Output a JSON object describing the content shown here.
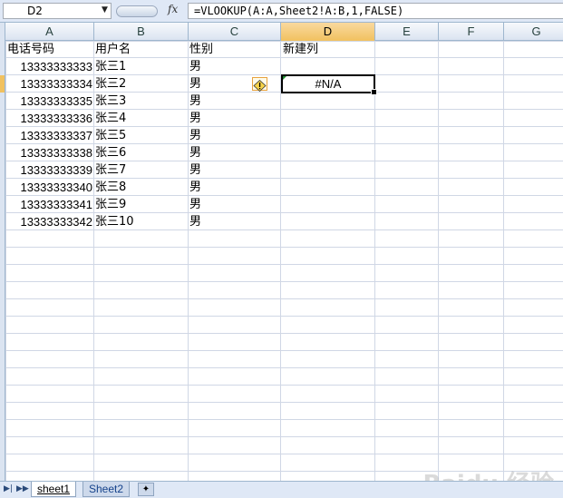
{
  "name_box": "D2",
  "formula": "=VLOOKUP(A:A,Sheet2!A:B,1,FALSE)",
  "fx_icon": "fx",
  "columns": [
    "A",
    "B",
    "C",
    "D",
    "E",
    "F",
    "G"
  ],
  "active_column": "D",
  "headers": {
    "a": "电话号码",
    "b": "用户名",
    "c": "性别",
    "d": "新建列"
  },
  "rows": [
    {
      "phone": "13333333333",
      "name": "张三1",
      "gender": "男"
    },
    {
      "phone": "13333333334",
      "name": "张三2",
      "gender": "男"
    },
    {
      "phone": "13333333335",
      "name": "张三3",
      "gender": "男"
    },
    {
      "phone": "13333333336",
      "name": "张三4",
      "gender": "男"
    },
    {
      "phone": "13333333337",
      "name": "张三5",
      "gender": "男"
    },
    {
      "phone": "13333333338",
      "name": "张三6",
      "gender": "男"
    },
    {
      "phone": "13333333339",
      "name": "张三7",
      "gender": "男"
    },
    {
      "phone": "13333333340",
      "name": "张三8",
      "gender": "男"
    },
    {
      "phone": "13333333341",
      "name": "张三9",
      "gender": "男"
    },
    {
      "phone": "13333333342",
      "name": "张三10",
      "gender": "男"
    }
  ],
  "d2_value": "#N/A",
  "error_icon": "warning-diamond-icon",
  "sheet_tabs": [
    "sheet1",
    "Sheet2"
  ],
  "active_sheet": "sheet1",
  "watermark": "Baidu 经验",
  "colors": {
    "accent": "#f1c15f",
    "chrome": "#dfe8f6",
    "gridline": "#d0d7e5"
  }
}
